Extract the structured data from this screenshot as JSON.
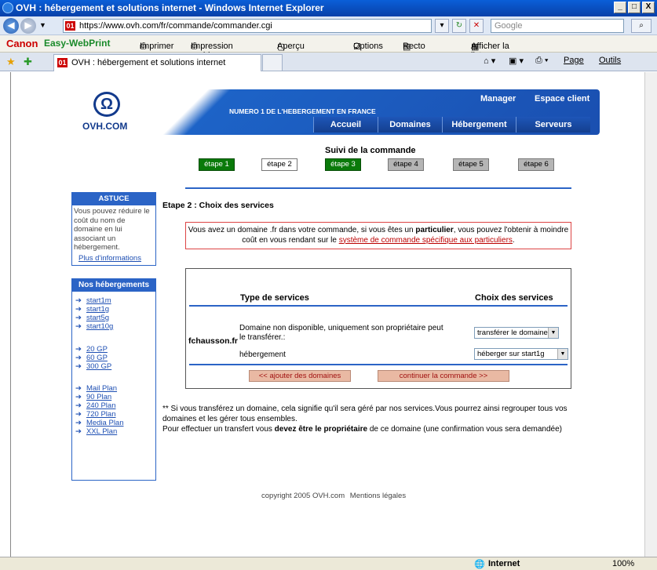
{
  "window": {
    "title": "OVH : hébergement et solutions internet - Windows Internet Explorer",
    "min": "_",
    "max": "□",
    "close": "X"
  },
  "address": {
    "url": "https://www.ovh.com/fr/commande/commander.cgi",
    "search_placeholder": "Google"
  },
  "canon_toolbar": {
    "brand": "Canon",
    "product": "Easy-WebPrint",
    "buttons": [
      "Imprimer",
      "Impression rapide",
      "Aperçu",
      "Options",
      "Recto verso",
      "Afficher la liste d'impressions"
    ]
  },
  "tab": {
    "title": "OVH : hébergement et solutions internet",
    "right_items": [
      "Page",
      "Outils"
    ]
  },
  "status": {
    "zone": "Internet",
    "zoom": "100%"
  },
  "header": {
    "logo": "Ω",
    "brand": "OVH.COM",
    "slogan": "NUMERO 1 DE L'HEBERGEMENT EN FRANCE",
    "links": [
      "Manager",
      "Espace client"
    ],
    "nav": [
      "Accueil",
      "Domaines",
      "Hébergement",
      "Serveurs"
    ]
  },
  "suivi": {
    "title": "Suivi de la commande",
    "steps": [
      "étape 1",
      "étape 2",
      "étape 3",
      "étape 4",
      "étape 5",
      "étape 6"
    ]
  },
  "astuce": {
    "title": "ASTUCE",
    "text": "Vous pouvez réduire le coût du nom de domaine en lui associant un hébergement.",
    "link": "Plus d'informations"
  },
  "hebergements": {
    "title": "Nos hébergements",
    "links": [
      "start1m",
      "start1g",
      "start5g",
      "start10g",
      "20 GP",
      "60 GP",
      "300 GP",
      "Mail Plan",
      "90 Plan",
      "240 Plan",
      "720 Plan",
      "Media Plan",
      "XXL Plan"
    ]
  },
  "main": {
    "heading": "Etape 2 : Choix des services",
    "notice_before": "Vous avez un domaine .fr dans votre commande, si vous êtes un ",
    "notice_bold": "particulier",
    "notice_after": ", vous pouvez l'obtenir à moindre coût en vous rendant sur le ",
    "notice_link": "système de commande spécifique aux particuliers",
    "notice_end": "."
  },
  "services": {
    "col_type": "Type de services",
    "col_choice": "Choix des services",
    "domain": "fchausson.fr",
    "row1_label": "Domaine non disponible, uniquement son propriétaire peut le transférer.:",
    "row1_value": "transférer le domaine",
    "row2_label": "hébergement",
    "row2_value": "héberger sur start1g",
    "btn_back": "<< ajouter des domaines",
    "btn_next": "continuer la commande >>"
  },
  "note": {
    "line1": "** Si vous transférez un domaine, cela signifie qu'il sera géré par nos services.Vous pourrez ainsi regrouper tous vos domaines et les gérer tous ensembles.",
    "line2_before": "Pour effectuer un transfert vous ",
    "line2_bold": "devez être le propriétaire",
    "line2_after": " de ce domaine (une confirmation vous sera demandée)"
  },
  "footer": {
    "copyright": "copyright 2005 OVH.com",
    "legal": "Mentions légales"
  }
}
